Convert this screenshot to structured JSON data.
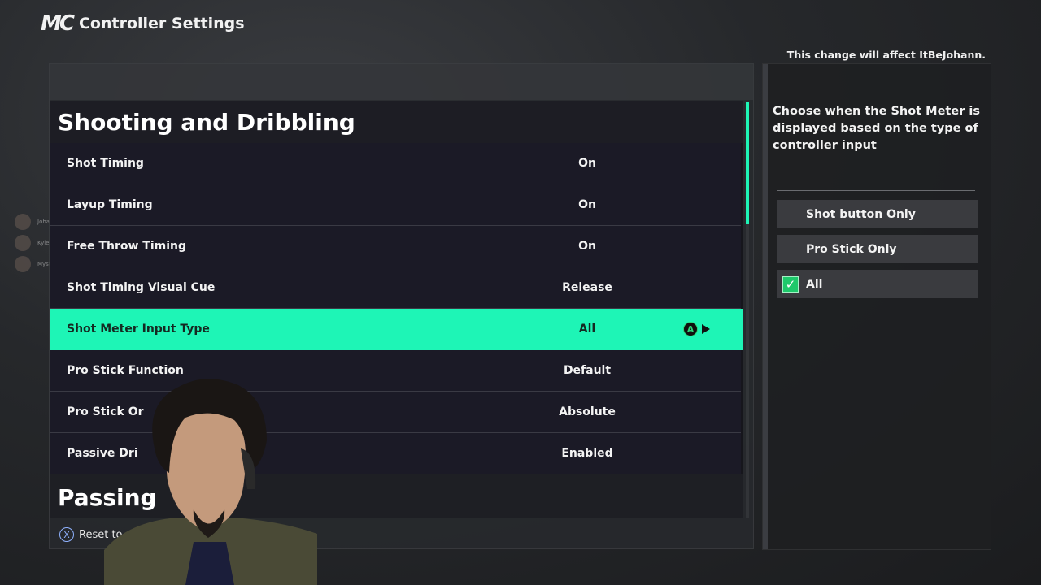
{
  "header": {
    "logo": "MC",
    "title": "Controller Settings"
  },
  "notice": "This change will affect ItBeJohann.",
  "sections": [
    {
      "title": "Shooting and Dribbling"
    },
    {
      "title": "Passing"
    }
  ],
  "rows": [
    {
      "label": "Shot Timing",
      "value": "On"
    },
    {
      "label": "Layup Timing",
      "value": "On"
    },
    {
      "label": "Free Throw Timing",
      "value": "On"
    },
    {
      "label": "Shot Timing Visual Cue",
      "value": "Release"
    },
    {
      "label": "Shot Meter Input Type",
      "value": "All"
    },
    {
      "label": "Pro Stick Function",
      "value": "Default"
    },
    {
      "label": "Pro Stick Or",
      "value": "Absolute"
    },
    {
      "label": "Passive Dri",
      "value": "Enabled"
    }
  ],
  "selected_row_button": "A",
  "footer": {
    "button": "X",
    "label": "Reset to de"
  },
  "description": "Choose when the Shot Meter is displayed based on the type of controller input",
  "options": [
    {
      "label": "Shot button Only",
      "checked": false
    },
    {
      "label": "Pro Stick Only",
      "checked": false
    },
    {
      "label": "All",
      "checked": true
    }
  ],
  "check_glyph": "✓",
  "friends": [
    {
      "name": "Johann"
    },
    {
      "name": "Kyle777"
    },
    {
      "name": "Mysto.not"
    }
  ],
  "colors": {
    "accent": "#1ef5b6",
    "checkbox": "#1ec96b",
    "a_button": "#2bd47a",
    "x_button": "#8fb2ff"
  }
}
